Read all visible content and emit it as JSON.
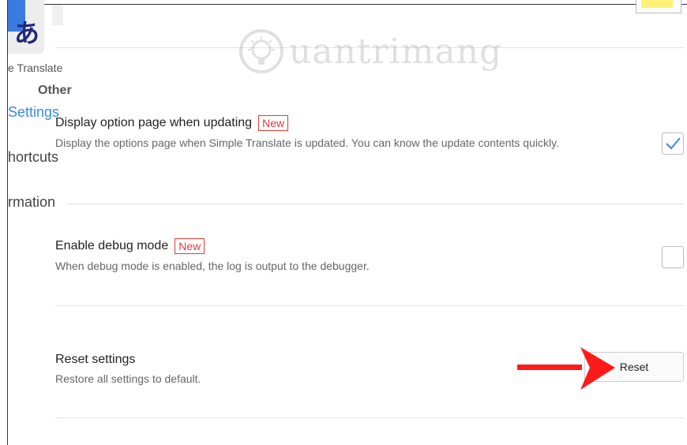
{
  "sidebar": {
    "app_icon_glyph": "あ",
    "app_name": "e Translate",
    "section_heading": "Other",
    "items": [
      {
        "label": "Settings"
      },
      {
        "label": "hortcuts"
      },
      {
        "label": "rmation"
      }
    ]
  },
  "watermark": {
    "text": "uantrimang"
  },
  "settings": [
    {
      "title": "Display option page when updating",
      "badge": "New",
      "description": "Display the options page when Simple Translate is updated. You can know the update contents quickly.",
      "checked": true
    },
    {
      "title": "Enable debug mode",
      "badge": "New",
      "description": "When debug mode is enabled, the log is output to the debugger.",
      "checked": false
    },
    {
      "title": "Reset settings",
      "description": "Restore all settings to default.",
      "button_label": "Reset"
    }
  ],
  "colors": {
    "accent": "#3b87e6",
    "badge": "#e53935",
    "annotation_arrow": "#ff1a1a"
  },
  "icons": {
    "checkmark": "check-icon",
    "arrow": "red-arrow-icon"
  }
}
